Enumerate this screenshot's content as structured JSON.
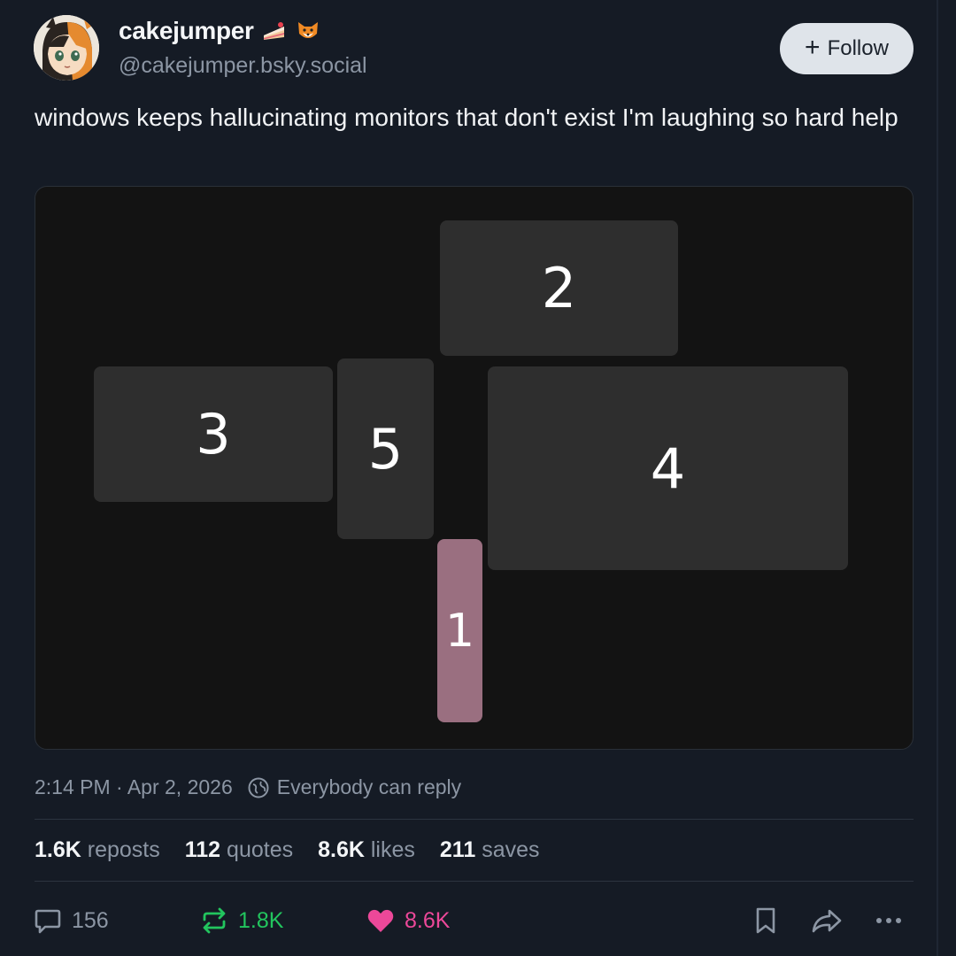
{
  "author": {
    "display_name": "cakejumper",
    "handle": "@cakejumper.bsky.social",
    "name_emojis": [
      "cake-slice-emoji",
      "fox-emoji"
    ]
  },
  "follow_button": {
    "label": "Follow"
  },
  "post": {
    "text": "windows keeps hallucinating monitors that don't exist I'm laughing so hard help",
    "image": {
      "monitors": [
        {
          "label": "2",
          "selected": false
        },
        {
          "label": "3",
          "selected": false
        },
        {
          "label": "5",
          "selected": false
        },
        {
          "label": "4",
          "selected": false
        },
        {
          "label": "1",
          "selected": true
        }
      ],
      "selected_color": "#9a6f80",
      "monitor_color": "#2e2e2e"
    },
    "timestamp": "2:14 PM · Apr 2, 2026",
    "reply_setting": "Everybody can reply"
  },
  "stats": {
    "reposts": {
      "count": "1.6K",
      "label": "reposts"
    },
    "quotes": {
      "count": "112",
      "label": "quotes"
    },
    "likes": {
      "count": "8.6K",
      "label": "likes"
    },
    "saves": {
      "count": "211",
      "label": "saves"
    }
  },
  "actions": {
    "reply_count": "156",
    "repost_count": "1.8K",
    "like_count": "8.6K",
    "icons": [
      "reply-icon",
      "repost-icon",
      "heart-icon",
      "bookmark-icon",
      "share-icon",
      "more-icon"
    ]
  },
  "colors": {
    "background": "#151b25",
    "repost_active": "#22c55e",
    "like_active": "#ec4899",
    "muted": "#8c96a4"
  }
}
